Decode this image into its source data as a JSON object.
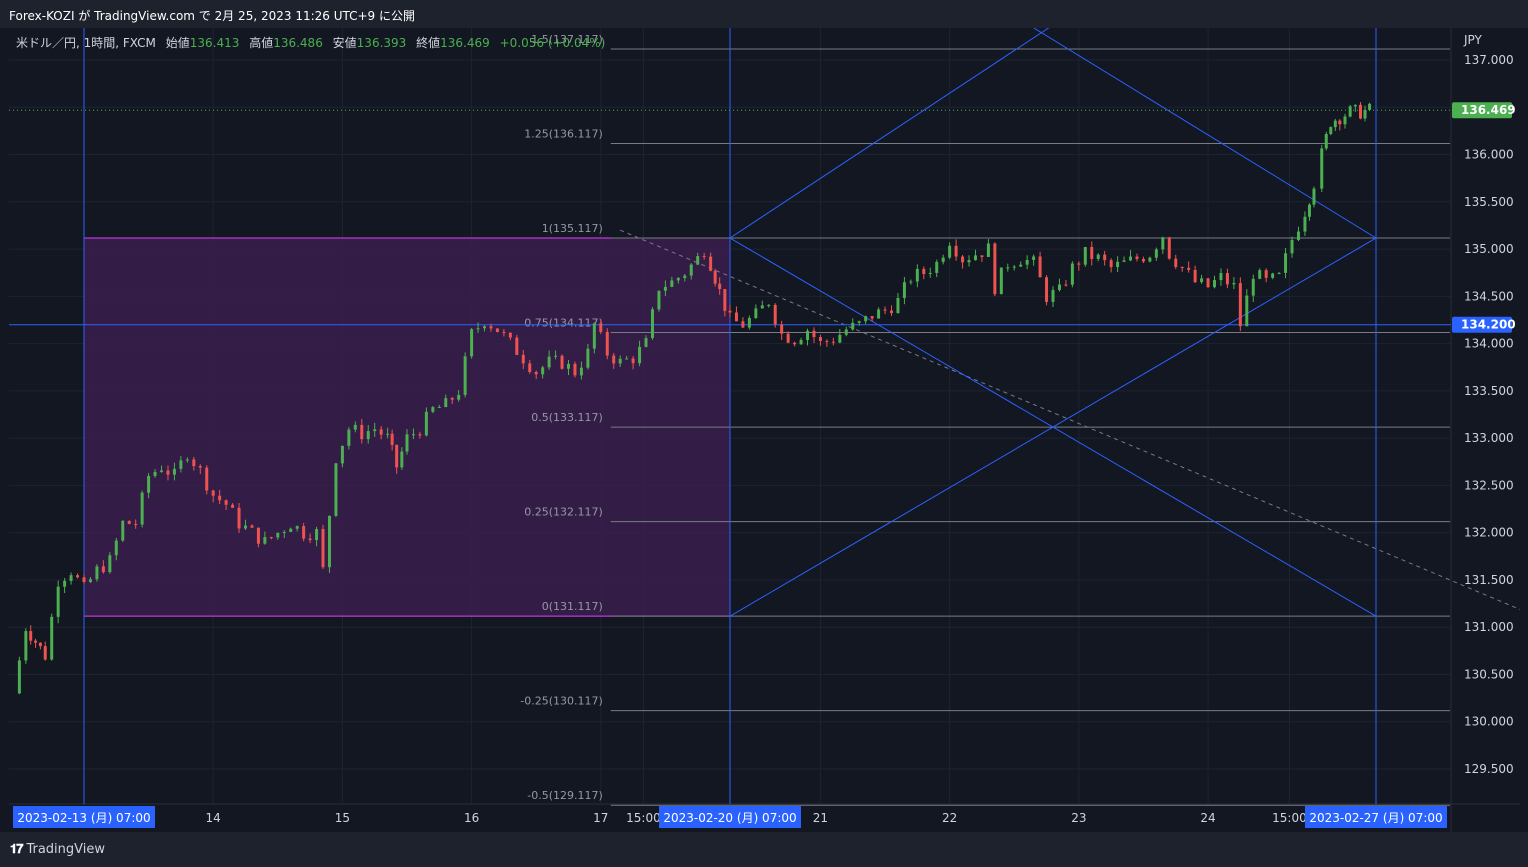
{
  "header": {
    "text": "Forex-KOZI が TradingView.com で 2月 25, 2023 11:26 UTC+9 に公開"
  },
  "legend": {
    "symbol": "米ドル／円, 1時間, FXCM",
    "open_label": "始値",
    "open": "136.413",
    "high_label": "高値",
    "high": "136.486",
    "low_label": "安値",
    "low": "136.393",
    "close_label": "終値",
    "close": "136.469",
    "change": "+0.056 (+0.04%)"
  },
  "footer": {
    "brand": "TradingView"
  },
  "colors": {
    "up": "#4caf50",
    "down": "#ef5350",
    "grid": "#1f2331",
    "blue_line": "#2962ff",
    "fib_line": "#787b86",
    "box_fill": "#3a1f4d",
    "box_edge": "#e040fb"
  },
  "chart_data": {
    "type": "candlestick",
    "currency": "JPY",
    "y_axis": {
      "unit": "JPY",
      "range": [
        129.17,
        137.45
      ],
      "ticks": [
        "129.500",
        "130.000",
        "130.500",
        "131.000",
        "131.500",
        "132.000",
        "132.500",
        "133.000",
        "133.500",
        "134.000",
        "134.500",
        "135.000",
        "135.500",
        "136.000",
        "136.500",
        "137.000"
      ]
    },
    "x_axis": {
      "labels": [
        {
          "text": "2023-02-13 (月)   07:00",
          "time": 0,
          "highlight": true
        },
        {
          "text": "14",
          "time": 1.0
        },
        {
          "text": "15",
          "time": 2.0
        },
        {
          "text": "16",
          "time": 3.0
        },
        {
          "text": "17",
          "time": 4.0
        },
        {
          "text": "15:00",
          "time": 4.33
        },
        {
          "text": "2023-02-20 (月)   07:00",
          "time": 5.0,
          "highlight": true
        },
        {
          "text": "21",
          "time": 5.7
        },
        {
          "text": "22",
          "time": 6.7
        },
        {
          "text": "23",
          "time": 7.7
        },
        {
          "text": "24",
          "time": 8.7
        },
        {
          "text": "15:00",
          "time": 9.33
        },
        {
          "text": "2023-02-27 (月)   07:00",
          "time": 10.0,
          "highlight": true
        }
      ]
    },
    "price_labels": [
      {
        "text": "136.469",
        "value": 136.469,
        "color": "#4caf50"
      },
      {
        "text": "134.200",
        "value": 134.2,
        "color": "#2962ff"
      }
    ],
    "fib_levels": [
      {
        "label": "1.5(137.117)",
        "value": 137.117
      },
      {
        "label": "1.25(136.117)",
        "value": 136.117
      },
      {
        "label": "1(135.117)",
        "value": 135.117
      },
      {
        "label": "0.75(134.117)",
        "value": 134.117
      },
      {
        "label": "0.5(133.117)",
        "value": 133.117
      },
      {
        "label": "0.25(132.117)",
        "value": 132.117
      },
      {
        "label": "0(131.117)",
        "value": 131.117
      },
      {
        "label": "-0.25(130.117)",
        "value": 130.117
      },
      {
        "label": "-0.5(129.117)",
        "value": 129.117
      }
    ],
    "range_box": {
      "t_start": 0,
      "t_end": 5.0,
      "top": 135.117,
      "bottom": 131.117
    },
    "horizontal_line": 134.2,
    "last_price_line": 136.469,
    "vertical_lines": [
      0,
      5.0,
      10.0
    ],
    "diagonals": [
      {
        "t1": 5.0,
        "p1": 135.117,
        "t2": 10.0,
        "p2": 131.117
      },
      {
        "t1": 5.0,
        "p1": 131.117,
        "t2": 10.0,
        "p2": 135.117
      },
      {
        "t1": 5.0,
        "p1": 135.117,
        "t2": 7.7,
        "p2": 137.55
      },
      {
        "t1": 7.1,
        "p1": 137.55,
        "t2": 10.0,
        "p2": 135.117
      }
    ],
    "dashed_trend": {
      "t1": 4.15,
      "p1": 135.2,
      "t2": 11.18,
      "p2": 131.15
    },
    "path": [
      {
        "t": -0.55,
        "p": 130.3
      },
      {
        "t": -0.45,
        "p": 131.0
      },
      {
        "t": -0.3,
        "p": 130.7
      },
      {
        "t": -0.2,
        "p": 131.5
      },
      {
        "t": -0.1,
        "p": 131.6
      },
      {
        "t": 0.0,
        "p": 131.4
      },
      {
        "t": 0.1,
        "p": 131.6
      },
      {
        "t": 0.2,
        "p": 131.7
      },
      {
        "t": 0.3,
        "p": 132.1
      },
      {
        "t": 0.4,
        "p": 132.1
      },
      {
        "t": 0.5,
        "p": 132.6
      },
      {
        "t": 0.6,
        "p": 132.7
      },
      {
        "t": 0.7,
        "p": 132.6
      },
      {
        "t": 0.8,
        "p": 132.85
      },
      {
        "t": 0.9,
        "p": 132.65
      },
      {
        "t": 1.0,
        "p": 132.4
      },
      {
        "t": 1.1,
        "p": 132.3
      },
      {
        "t": 1.2,
        "p": 132.1
      },
      {
        "t": 1.3,
        "p": 132.0
      },
      {
        "t": 1.4,
        "p": 131.9
      },
      {
        "t": 1.5,
        "p": 132.0
      },
      {
        "t": 1.6,
        "p": 132.1
      },
      {
        "t": 1.7,
        "p": 132.0
      },
      {
        "t": 1.8,
        "p": 132.0
      },
      {
        "t": 1.85,
        "p": 131.6
      },
      {
        "t": 1.95,
        "p": 132.8
      },
      {
        "t": 2.05,
        "p": 133.1
      },
      {
        "t": 2.15,
        "p": 133.05
      },
      {
        "t": 2.25,
        "p": 133.1
      },
      {
        "t": 2.35,
        "p": 133.0
      },
      {
        "t": 2.42,
        "p": 132.7
      },
      {
        "t": 2.5,
        "p": 133.0
      },
      {
        "t": 2.6,
        "p": 133.1
      },
      {
        "t": 2.7,
        "p": 133.3
      },
      {
        "t": 2.8,
        "p": 133.35
      },
      {
        "t": 2.9,
        "p": 133.5
      },
      {
        "t": 3.0,
        "p": 134.1
      },
      {
        "t": 3.1,
        "p": 134.25
      },
      {
        "t": 3.2,
        "p": 134.15
      },
      {
        "t": 3.3,
        "p": 134.0
      },
      {
        "t": 3.4,
        "p": 133.85
      },
      {
        "t": 3.5,
        "p": 133.7
      },
      {
        "t": 3.6,
        "p": 133.8
      },
      {
        "t": 3.7,
        "p": 133.8
      },
      {
        "t": 3.8,
        "p": 133.7
      },
      {
        "t": 3.9,
        "p": 133.9
      },
      {
        "t": 3.95,
        "p": 134.2
      },
      {
        "t": 4.05,
        "p": 133.9
      },
      {
        "t": 4.15,
        "p": 133.8
      },
      {
        "t": 4.25,
        "p": 133.85
      },
      {
        "t": 4.35,
        "p": 134.0
      },
      {
        "t": 4.45,
        "p": 134.6
      },
      {
        "t": 4.55,
        "p": 134.65
      },
      {
        "t": 4.65,
        "p": 134.75
      },
      {
        "t": 4.75,
        "p": 134.9
      },
      {
        "t": 4.8,
        "p": 135.0
      },
      {
        "t": 4.85,
        "p": 134.85
      },
      {
        "t": 4.92,
        "p": 134.55
      },
      {
        "t": 5.0,
        "p": 134.25
      },
      {
        "t": 5.1,
        "p": 134.2
      },
      {
        "t": 5.2,
        "p": 134.3
      },
      {
        "t": 5.3,
        "p": 134.45
      },
      {
        "t": 5.4,
        "p": 134.1
      },
      {
        "t": 5.5,
        "p": 134.05
      },
      {
        "t": 5.6,
        "p": 134.15
      },
      {
        "t": 5.7,
        "p": 134.0
      },
      {
        "t": 5.8,
        "p": 134.05
      },
      {
        "t": 5.9,
        "p": 134.15
      },
      {
        "t": 6.0,
        "p": 134.2
      },
      {
        "t": 6.1,
        "p": 134.3
      },
      {
        "t": 6.2,
        "p": 134.35
      },
      {
        "t": 6.3,
        "p": 134.45
      },
      {
        "t": 6.4,
        "p": 134.7
      },
      {
        "t": 6.5,
        "p": 134.75
      },
      {
        "t": 6.6,
        "p": 134.85
      },
      {
        "t": 6.7,
        "p": 135.1
      },
      {
        "t": 6.8,
        "p": 134.9
      },
      {
        "t": 6.9,
        "p": 134.95
      },
      {
        "t": 7.0,
        "p": 135.0
      },
      {
        "t": 7.05,
        "p": 134.6
      },
      {
        "t": 7.15,
        "p": 134.85
      },
      {
        "t": 7.25,
        "p": 134.9
      },
      {
        "t": 7.35,
        "p": 134.85
      },
      {
        "t": 7.45,
        "p": 134.5
      },
      {
        "t": 7.55,
        "p": 134.55
      },
      {
        "t": 7.65,
        "p": 134.8
      },
      {
        "t": 7.75,
        "p": 134.95
      },
      {
        "t": 7.85,
        "p": 134.9
      },
      {
        "t": 7.95,
        "p": 134.8
      },
      {
        "t": 8.05,
        "p": 134.85
      },
      {
        "t": 8.15,
        "p": 134.9
      },
      {
        "t": 8.25,
        "p": 134.95
      },
      {
        "t": 8.35,
        "p": 135.15
      },
      {
        "t": 8.4,
        "p": 134.95
      },
      {
        "t": 8.5,
        "p": 134.8
      },
      {
        "t": 8.6,
        "p": 134.65
      },
      {
        "t": 8.7,
        "p": 134.6
      },
      {
        "t": 8.8,
        "p": 134.7
      },
      {
        "t": 8.9,
        "p": 134.6
      },
      {
        "t": 8.95,
        "p": 134.2
      },
      {
        "t": 9.05,
        "p": 134.75
      },
      {
        "t": 9.15,
        "p": 134.65
      },
      {
        "t": 9.25,
        "p": 134.7
      },
      {
        "t": 9.35,
        "p": 135.1
      },
      {
        "t": 9.45,
        "p": 135.4
      },
      {
        "t": 9.52,
        "p": 135.7
      },
      {
        "t": 9.58,
        "p": 136.0
      },
      {
        "t": 9.65,
        "p": 136.35
      },
      {
        "t": 9.72,
        "p": 136.4
      },
      {
        "t": 9.8,
        "p": 136.45
      },
      {
        "t": 9.88,
        "p": 136.45
      },
      {
        "t": 9.95,
        "p": 136.469
      }
    ]
  }
}
